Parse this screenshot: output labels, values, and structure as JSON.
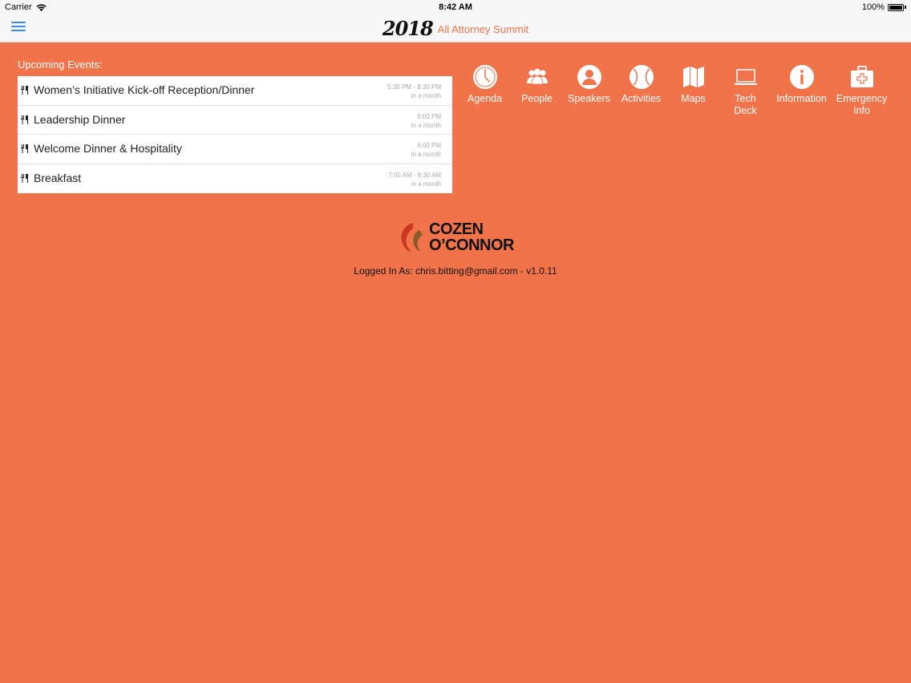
{
  "status_bar": {
    "carrier": "Carrier",
    "time": "8:42 AM",
    "battery": "100%"
  },
  "header": {
    "year": "2018",
    "subtitle": "All Attorney Summit"
  },
  "upcoming": {
    "label": "Upcoming Events:",
    "events": [
      {
        "name": "Women’s Initiative Kick-off Reception/Dinner",
        "time": "5:30 PM - 8:30 PM",
        "relative": "in a month"
      },
      {
        "name": "Leadership Dinner",
        "time": "6:00 PM",
        "relative": "in a month"
      },
      {
        "name": "Welcome Dinner & Hospitality",
        "time": "6:00 PM",
        "relative": "in a month"
      },
      {
        "name": "Breakfast",
        "time": "7:00 AM - 8:30 AM",
        "relative": "in a month"
      }
    ]
  },
  "nav": [
    {
      "label": "Agenda",
      "icon": "clock-icon"
    },
    {
      "label": "People",
      "icon": "people-icon"
    },
    {
      "label": "Speakers",
      "icon": "person-icon"
    },
    {
      "label": "Activities",
      "icon": "baseball-icon"
    },
    {
      "label": "Maps",
      "icon": "map-icon"
    },
    {
      "label": "Tech\nDeck",
      "icon": "laptop-icon"
    },
    {
      "label": "Information",
      "icon": "info-icon"
    },
    {
      "label": "Emergency\nInfo",
      "icon": "first-aid-icon"
    }
  ],
  "footer": {
    "logo_line1": "COZEN",
    "logo_line2": "O’CONNOR",
    "login_text": "Logged In As: chris.bitting@gmail.com - v1.0.11"
  },
  "colors": {
    "background": "#F1734A",
    "accent_blue": "#3A88F0",
    "bar": "#F7F7F7"
  }
}
